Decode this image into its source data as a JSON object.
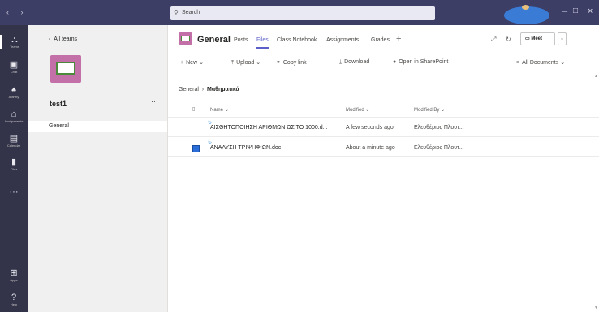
{
  "titlebar": {
    "search_placeholder": "Search",
    "search_icon": "search-icon",
    "window_controls": [
      "–",
      "□",
      "×"
    ]
  },
  "rail": [
    {
      "label": "Teams",
      "icon": "teams-icon",
      "glyph": "⛬"
    },
    {
      "label": "Chat",
      "icon": "chat-icon",
      "glyph": "▣"
    },
    {
      "label": "Activity",
      "icon": "bell-icon",
      "glyph": "♠"
    },
    {
      "label": "Assignments",
      "icon": "assignments-icon",
      "glyph": "⌂"
    },
    {
      "label": "Calendar",
      "icon": "calendar-icon",
      "glyph": "▤"
    },
    {
      "label": "Files",
      "icon": "files-icon",
      "glyph": "▮"
    },
    {
      "label": "",
      "icon": "more-apps-icon",
      "glyph": "···"
    },
    {
      "label": "Apps",
      "icon": "apps-icon",
      "glyph": "⊞"
    },
    {
      "label": "Help",
      "icon": "help-icon",
      "glyph": "?"
    }
  ],
  "teampane": {
    "back_label": "All teams",
    "team_name": "test1",
    "more": "···",
    "channel": "General"
  },
  "channel_header": {
    "title": "General",
    "tabs": [
      {
        "label": "Posts",
        "active": false
      },
      {
        "label": "Files",
        "active": true
      },
      {
        "label": "Class Notebook",
        "active": false
      },
      {
        "label": "Assignments",
        "active": false
      },
      {
        "label": "Grades",
        "active": false
      }
    ],
    "add_tab": "+",
    "meet_label": "Meet",
    "meet_icon": "video-icon"
  },
  "toolbar": {
    "new": "New",
    "upload": "Upload",
    "copy_link": "Copy link",
    "download": "Download",
    "open_sharepoint": "Open in SharePoint",
    "all_documents": "All Documents"
  },
  "breadcrumb": {
    "parent": "General",
    "current": "Μαθηματικά"
  },
  "columns": {
    "name": "Name",
    "modified": "Modified",
    "modified_by": "Modified By"
  },
  "files": [
    {
      "name": "ΑΙΣΘΗΤΟΠΟΙΗΣΗ ΑΡΙΘΜΩΝ ΩΣ ΤΟ 1000.d...",
      "modified": "A few seconds ago",
      "modified_by": "Ελευθέριος Πλουτ...",
      "selected": false
    },
    {
      "name": "ΑΝΑΛΥΣΗ ΤΡΙΨΗΦΙΩΝ.doc",
      "modified": "About a minute ago",
      "modified_by": "Ελευθέριος Πλουτ...",
      "selected": true
    }
  ],
  "colors": {
    "titlebar": "#3d3e66",
    "rail": "#33344a",
    "accent": "#5b5fc7",
    "team_tile": "#c36fa8"
  }
}
